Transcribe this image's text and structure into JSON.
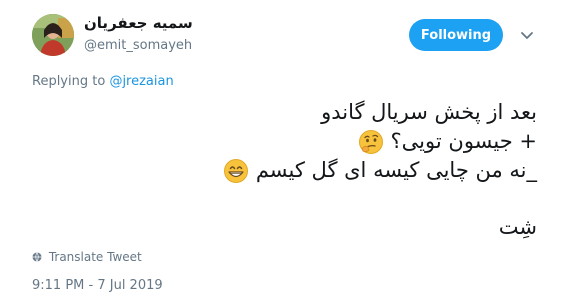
{
  "author": {
    "display_name": "سمیه جعفریان",
    "handle": "@emit_somayeh",
    "avatar_icon": "profile-photo"
  },
  "follow_button": {
    "label": "Following",
    "color": "#1da1f2"
  },
  "menu": {
    "icon": "chevron-down-icon"
  },
  "reply": {
    "prefix": "Replying to",
    "mention": "@jrezaian"
  },
  "tweet": {
    "line1": "بعد از پخش سریال گاندو",
    "line2": "+ جیسون تویی؟",
    "line3": "_نه من چایی کیسه ای گل کیسم",
    "line4": "شِت",
    "emoji_line2": "thinking-face",
    "emoji_line3": "grinning-face"
  },
  "translate": {
    "label": "Translate Tweet",
    "icon": "globe-icon"
  },
  "meta": {
    "timestamp": "9:11 PM - 7 Jul 2019"
  },
  "colors": {
    "link": "#1b95e0",
    "muted": "#657786",
    "text": "#14171a"
  }
}
